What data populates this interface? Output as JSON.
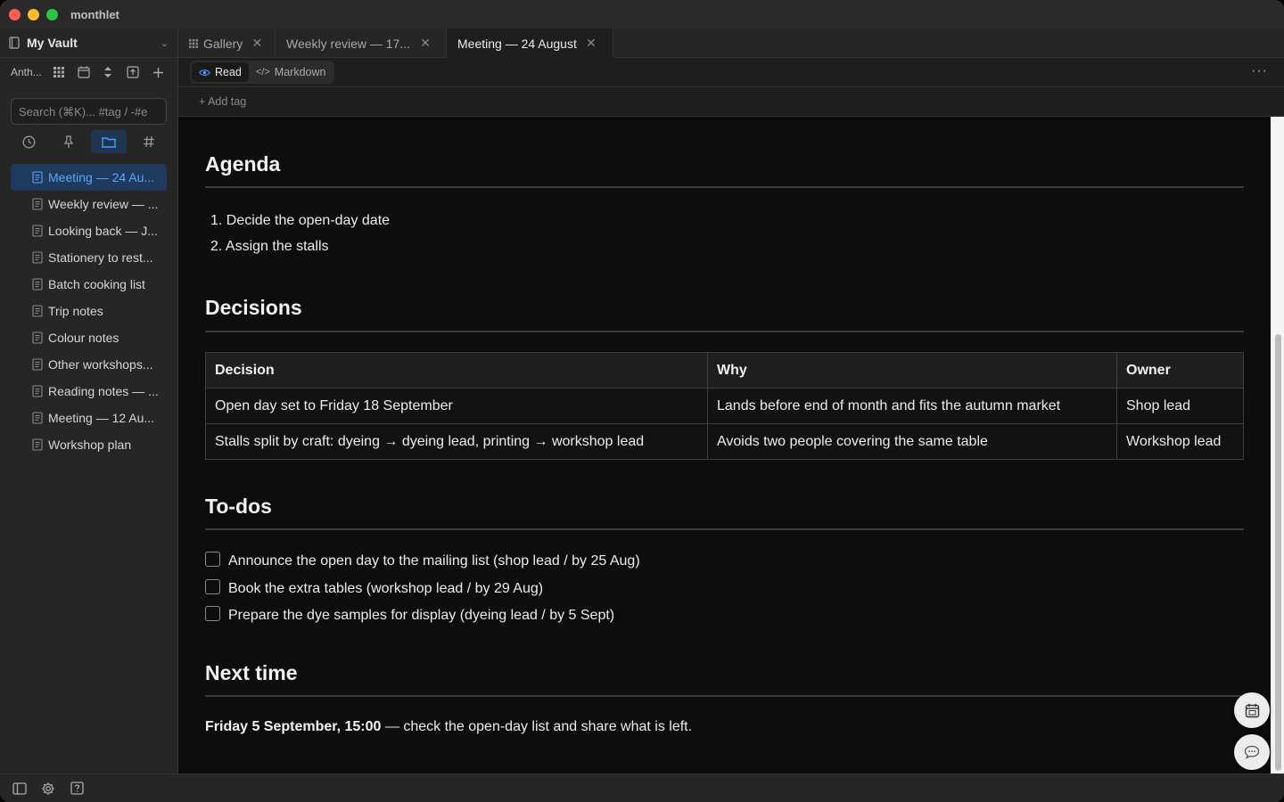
{
  "app": {
    "title": "monthlet"
  },
  "sidebar": {
    "vault_name": "My Vault",
    "toolbar_label": "Anth...",
    "search_placeholder": "Search (⌘K)... #tag / -#e",
    "files": [
      {
        "label": "Meeting — 24 Au...",
        "active": true
      },
      {
        "label": "Weekly review — ...",
        "active": false
      },
      {
        "label": "Looking back — J...",
        "active": false
      },
      {
        "label": "Stationery to rest...",
        "active": false
      },
      {
        "label": "Batch cooking list",
        "active": false
      },
      {
        "label": "Trip notes",
        "active": false
      },
      {
        "label": "Colour notes",
        "active": false
      },
      {
        "label": "Other workshops...",
        "active": false
      },
      {
        "label": "Reading notes — ...",
        "active": false
      },
      {
        "label": "Meeting — 12 Au...",
        "active": false
      },
      {
        "label": "Workshop plan",
        "active": false
      }
    ]
  },
  "tabs": [
    {
      "label": "Gallery",
      "icon": "grid-icon",
      "active": false
    },
    {
      "label": "Weekly review — 17...",
      "active": false
    },
    {
      "label": "Meeting — 24 August",
      "active": true
    }
  ],
  "mode": {
    "read_label": "Read",
    "markdown_label": "Markdown",
    "active": "read"
  },
  "tagbar": {
    "add_tag_label": "+ Add tag"
  },
  "document": {
    "agenda": {
      "heading": "Agenda",
      "items": [
        "1. Decide the open-day date",
        "2. Assign the stalls"
      ]
    },
    "decisions": {
      "heading": "Decisions",
      "columns": [
        "Decision",
        "Why",
        "Owner"
      ],
      "rows": [
        [
          "Open day set to Friday 18 September",
          "Lands before end of month and fits the autumn market",
          "Shop lead"
        ],
        [
          "Stalls split by craft: dyeing → dyeing lead, printing → workshop lead",
          "Avoids two people covering the same table",
          "Workshop lead"
        ]
      ]
    },
    "todos": {
      "heading": "To-dos",
      "items": [
        {
          "text": "Announce the open day to the mailing list (shop lead / by 25 Aug)",
          "checked": false
        },
        {
          "text": "Book the extra tables (workshop lead / by 29 Aug)",
          "checked": false
        },
        {
          "text": "Prepare the dye samples for display (dyeing lead / by 5 Sept)",
          "checked": false
        }
      ]
    },
    "next_time": {
      "heading": "Next time",
      "bold": "Friday 5 September, 15:00",
      "rest": " — check the open-day list and share what is left."
    }
  },
  "colors": {
    "accent": "#4a9eff",
    "active_item_bg": "#1f3a5c",
    "content_bg": "#0d0d0d",
    "sidebar_bg": "#262626"
  }
}
